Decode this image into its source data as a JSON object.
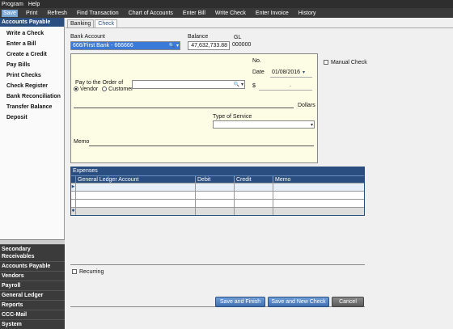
{
  "menubar": {
    "items": [
      "Program",
      "Help"
    ]
  },
  "toolbar": {
    "items": [
      "Save",
      "Print",
      "Refresh",
      "Find Transaction",
      "Chart of Accounts",
      "Enter Bill",
      "Write Check",
      "Enter Invoice",
      "History"
    ]
  },
  "sidebar": {
    "header": "Accounts Payable",
    "items": [
      "Write a Check",
      "Enter a Bill",
      "Create a Credit",
      "Pay Bills",
      "Print Checks",
      "Check Register",
      "Bank Reconciliation",
      "Transfer Balance",
      "Deposit"
    ],
    "categories": [
      "Secondary Receivables",
      "Accounts Payable",
      "Vendors",
      "Payroll",
      "General Ledger",
      "Reports",
      "CCC-Mail",
      "System"
    ]
  },
  "tabs": [
    "Banking",
    "Check"
  ],
  "form": {
    "bank_account_label": "Bank Account",
    "bank_account_value": "666/First Bank - 666666",
    "balance_label": "Balance",
    "balance_value": "47,632,733.88",
    "gl_label": "GL",
    "gl_value": "000000",
    "manual_check_label": "Manual Check",
    "no_label": "No.",
    "date_label": "Date",
    "date_value": "01/08/2016",
    "pay_to_label": "Pay to the Order of",
    "vendor_label": "Vendor",
    "customer_label": "Customer",
    "dollar_sign": "$",
    "amount_dot": ".",
    "dollars_label": "Dollars",
    "type_of_service_label": "Type of Service",
    "memo_label": "Memo"
  },
  "expenses": {
    "title": "Expenses",
    "columns": [
      "General Ledger Account",
      "Debit",
      "Credit",
      "Memo"
    ],
    "row_markers": [
      "▶",
      "",
      "",
      "✱"
    ]
  },
  "recurring_label": "Recurring",
  "buttons": {
    "save_finish": "Save and Finish",
    "save_new": "Save and New Check",
    "cancel": "Cancel"
  }
}
